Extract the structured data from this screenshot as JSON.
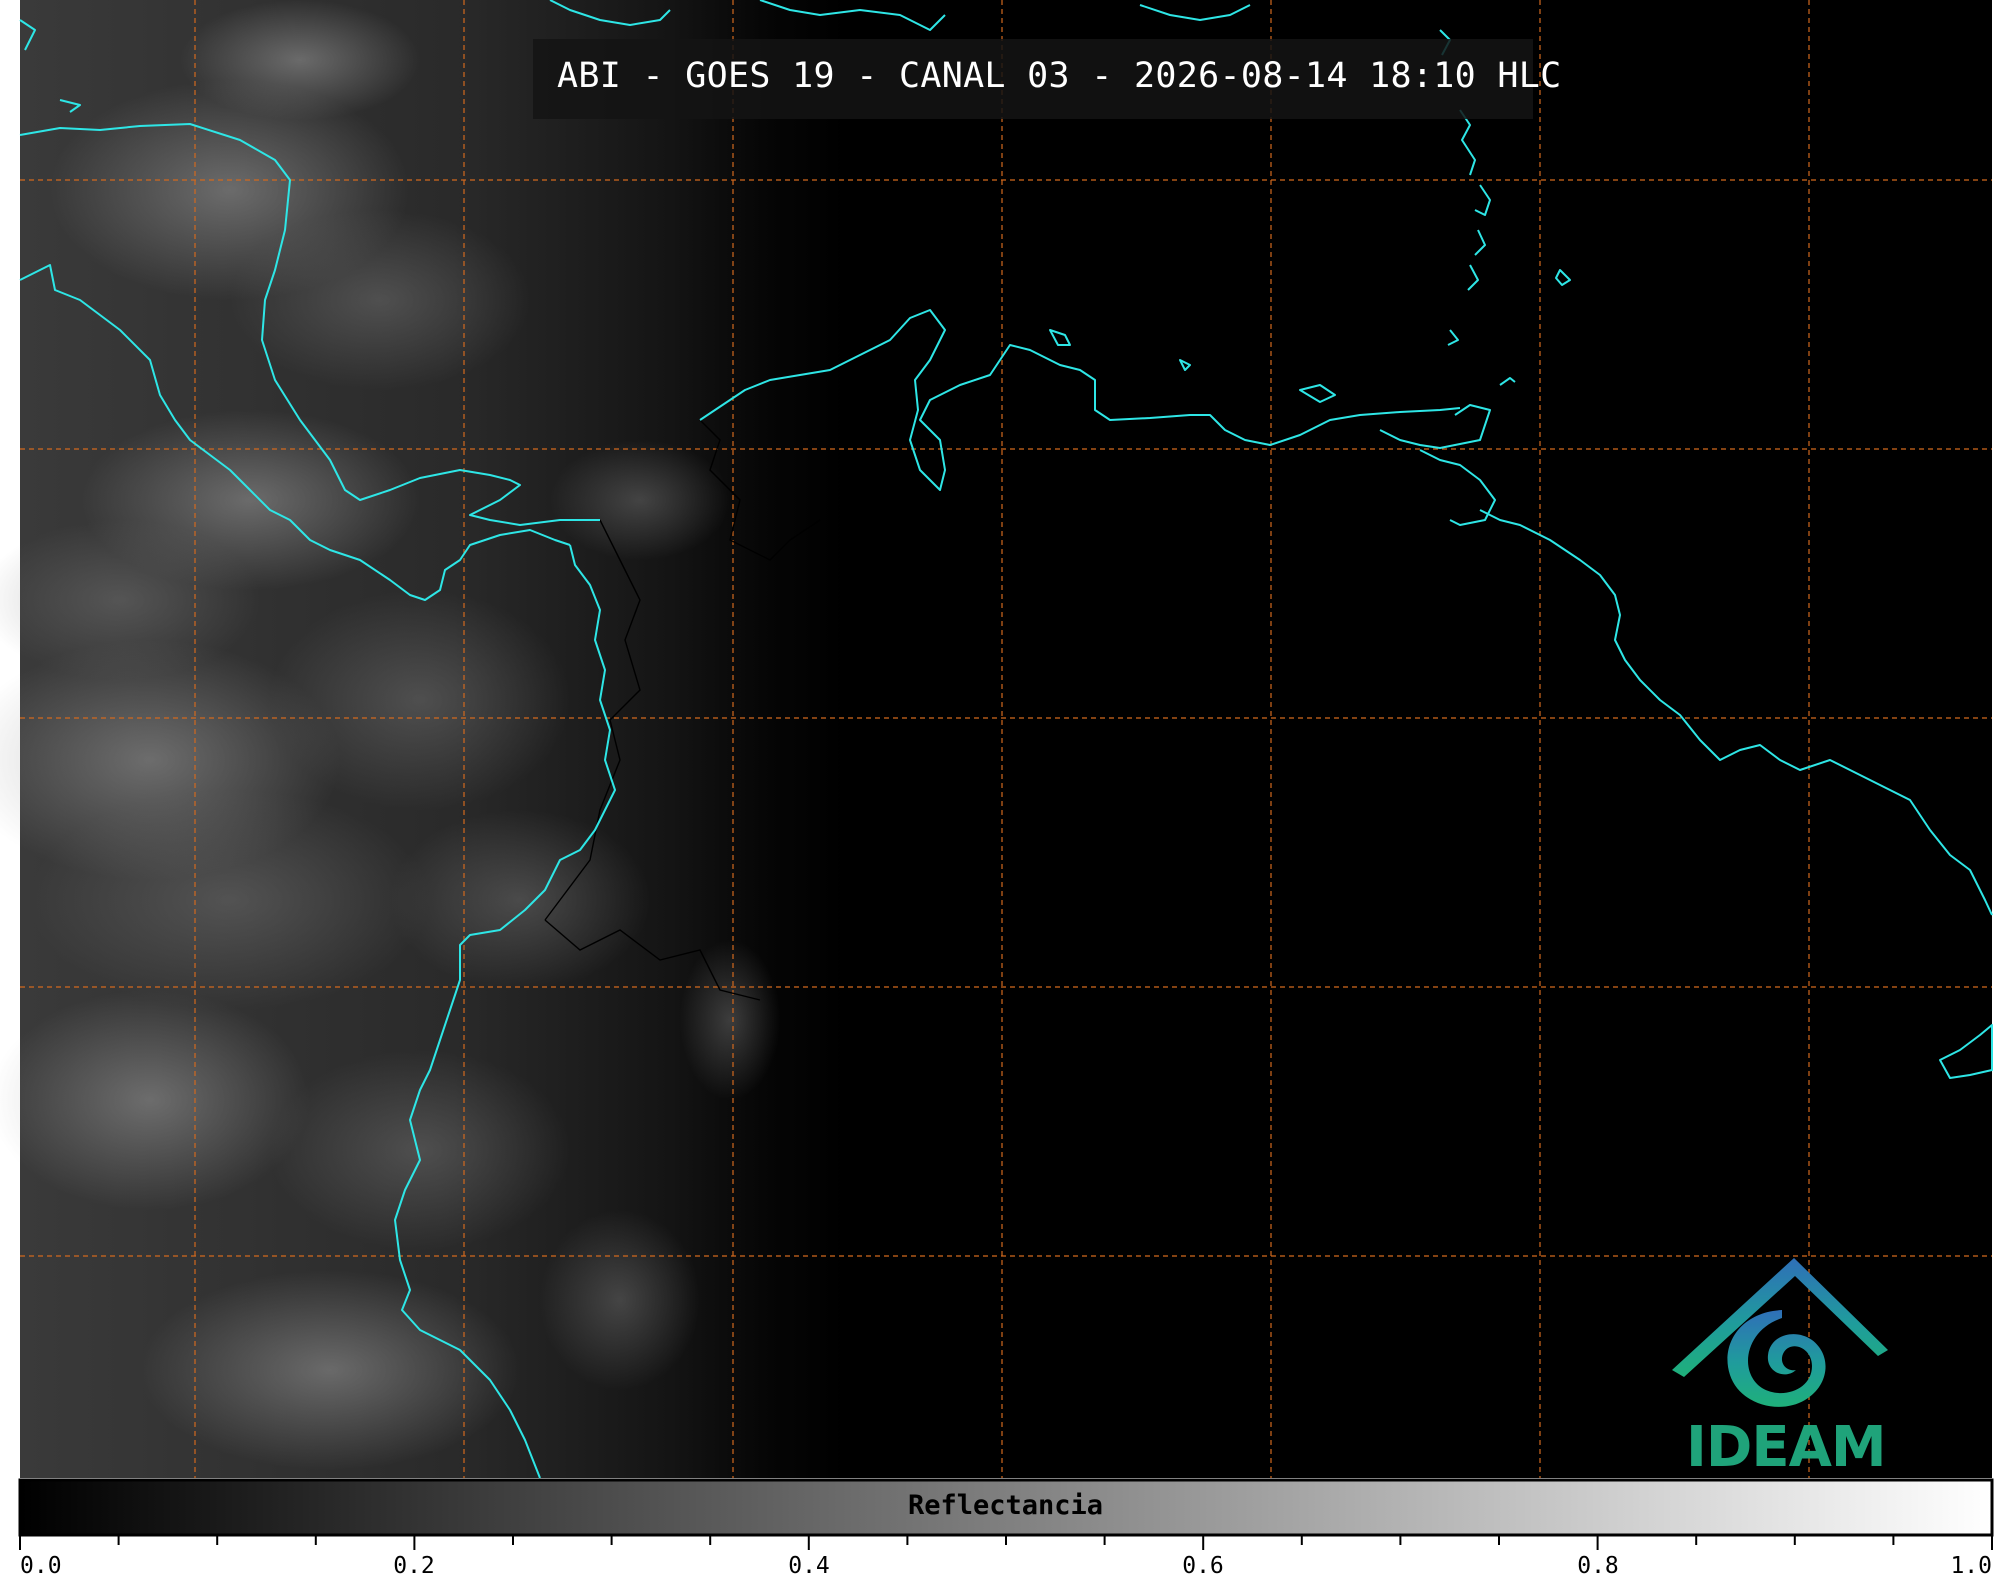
{
  "title": "ABI - GOES 19 - CANAL 03 - 2026-08-14 18:10 HLC",
  "logo": {
    "text": "IDEAM",
    "color": "#1fa37a"
  },
  "colorbar": {
    "label": "Reflectancia",
    "ticks": [
      "0.0",
      "0.2",
      "0.4",
      "0.6",
      "0.8",
      "1.0"
    ],
    "range": [
      0.0,
      1.0
    ],
    "colormap": "grayscale"
  },
  "colors": {
    "coastline": "#2ee6e6",
    "borders": "#000000",
    "gridlines": "#d2691e",
    "ocean_night": "#000000"
  },
  "gridlines": "dashed"
}
